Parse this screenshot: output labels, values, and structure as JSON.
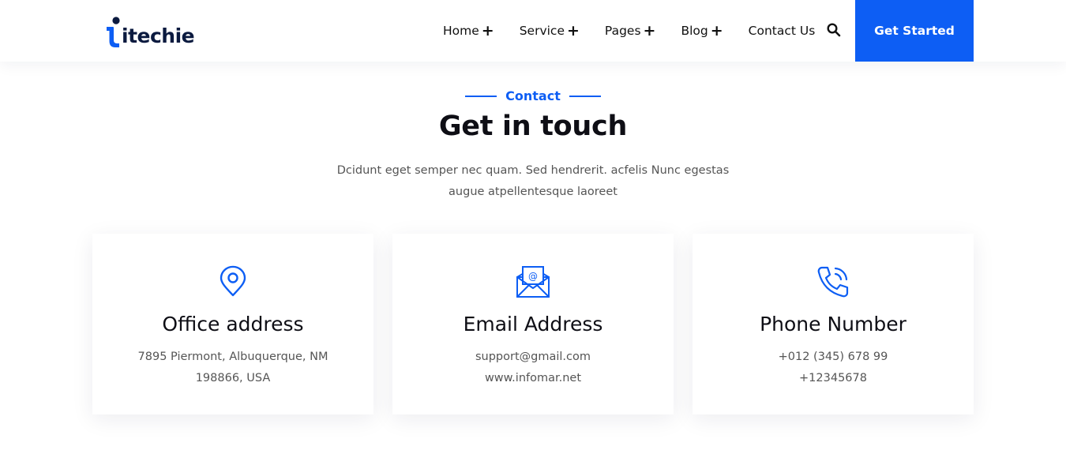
{
  "brand": {
    "name": "itechie",
    "accent": "#0d5ef4",
    "dark": "#0b1a3f"
  },
  "nav": {
    "items": [
      {
        "label": "Home",
        "has_submenu": true
      },
      {
        "label": "Service",
        "has_submenu": true
      },
      {
        "label": "Pages",
        "has_submenu": true
      },
      {
        "label": "Blog",
        "has_submenu": true
      },
      {
        "label": "Contact Us",
        "has_submenu": false
      }
    ],
    "submenu_glyph": "+",
    "search_icon": "search-icon",
    "cta_label": "Get Started"
  },
  "section": {
    "eyebrow": "Contact",
    "title": "Get in touch",
    "description_line1": "Dcidunt eget semper nec quam. Sed hendrerit. acfelis Nunc egestas",
    "description_line2": "augue atpellentesque laoreet"
  },
  "cards": [
    {
      "icon": "location-pin-icon",
      "title": "Office address",
      "line1": "7895 Piermont, Albuquerque, NM",
      "line2": "198866, USA"
    },
    {
      "icon": "email-envelope-icon",
      "title": "Email Address",
      "line1": "support@gmail.com",
      "line2": "www.infomar.net"
    },
    {
      "icon": "phone-call-icon",
      "title": "Phone Number",
      "line1": "+012 (345) 678 99",
      "line2": "+12345678"
    }
  ]
}
